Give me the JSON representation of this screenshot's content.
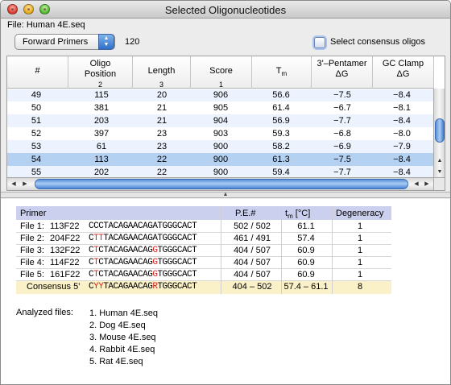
{
  "window": {
    "title": "Selected Oligonucleotides"
  },
  "file_label": "File: Human 4E.seq",
  "toolbar": {
    "primer_popup": "Forward Primers",
    "count": "120",
    "consensus_checkbox_label": "Select consensus oligos",
    "consensus_checked": false
  },
  "table": {
    "headers": [
      {
        "line1": "#",
        "line2": "",
        "sort": ""
      },
      {
        "line1": "Oligo",
        "line2": "Position",
        "sort": "2"
      },
      {
        "line1": "Length",
        "line2": "",
        "sort": "3"
      },
      {
        "line1": "Score",
        "line2": "",
        "sort": "1"
      },
      {
        "line1": "Tm",
        "line2": "",
        "sort": ""
      },
      {
        "line1": "3'–Pentamer",
        "line2": "ΔG",
        "sort": ""
      },
      {
        "line1": "GC Clamp",
        "line2": "ΔG",
        "sort": ""
      }
    ],
    "rows": [
      [
        "49",
        "115",
        "20",
        "906",
        "56.6",
        "−7.5",
        "−8.4"
      ],
      [
        "50",
        "381",
        "21",
        "905",
        "61.4",
        "−6.7",
        "−8.1"
      ],
      [
        "51",
        "203",
        "21",
        "904",
        "56.9",
        "−7.7",
        "−8.4"
      ],
      [
        "52",
        "397",
        "23",
        "903",
        "59.3",
        "−6.8",
        "−8.0"
      ],
      [
        "53",
        "61",
        "23",
        "900",
        "58.2",
        "−6.9",
        "−7.9"
      ],
      [
        "54",
        "113",
        "22",
        "900",
        "61.3",
        "−7.5",
        "−8.4"
      ],
      [
        "55",
        "202",
        "22",
        "900",
        "59.4",
        "−7.7",
        "−8.4"
      ]
    ],
    "selected_row_index": 5
  },
  "consensus": {
    "headers": {
      "primer": "Primer",
      "pe": "P.E.#",
      "tm": "tm [°C]",
      "degeneracy": "Degeneracy"
    },
    "rows": [
      {
        "label": "File 1:",
        "id": "113F22",
        "seq_before": "CCCTACAGAACAGATGGGCACT",
        "seq_red": "",
        "seq_mid": "",
        "seq_red2": "",
        "seq_after": "",
        "pe": "502 / 502",
        "tm": "61.1",
        "deg": "1"
      },
      {
        "label": "File 2:",
        "id": "204F22",
        "seq_before": "C",
        "seq_red": "TT",
        "seq_mid": "TACAGAACAGATGGGCACT",
        "seq_red2": "",
        "seq_after": "",
        "pe": "461 / 491",
        "tm": "57.4",
        "deg": "1"
      },
      {
        "label": "File 3:",
        "id": "132F22",
        "seq_before": "C",
        "seq_red": "T",
        "seq_mid": "CTACAGAACAG",
        "seq_red2": "G",
        "seq_after": "TGGGCACT",
        "pe": "404 / 507",
        "tm": "60.9",
        "deg": "1"
      },
      {
        "label": "File 4:",
        "id": "114F22",
        "seq_before": "C",
        "seq_red": "T",
        "seq_mid": "CTACAGAACAG",
        "seq_red2": "G",
        "seq_after": "TGGGCACT",
        "pe": "404 / 507",
        "tm": "60.9",
        "deg": "1"
      },
      {
        "label": "File 5:",
        "id": "161F22",
        "seq_before": "C",
        "seq_red": "T",
        "seq_mid": "CTACAGAACAG",
        "seq_red2": "G",
        "seq_after": "TGGGCACT",
        "pe": "404 / 507",
        "tm": "60.9",
        "deg": "1"
      }
    ],
    "consensus_row": {
      "label": "Consensus 5'",
      "seq_before": "C",
      "seq_red": "YY",
      "seq_mid": "TACAGAACAG",
      "seq_red2": "R",
      "seq_after": "TGGGCACT",
      "pe": "404 – 502",
      "tm": "57.4 – 61.1",
      "deg": "8"
    }
  },
  "analyzed": {
    "label": "Analyzed files:",
    "files": [
      "1. Human 4E.seq",
      "2. Dog 4E.seq",
      "3. Mouse 4E.seq",
      "4. Rabbit 4E.seq",
      "5. Rat 4E.seq"
    ]
  },
  "colors": {
    "selection": "#b5d1f2",
    "mismatch": "#e0201a",
    "consensus_bg": "#fbf1c8",
    "header_bg": "#cbd0ee"
  }
}
